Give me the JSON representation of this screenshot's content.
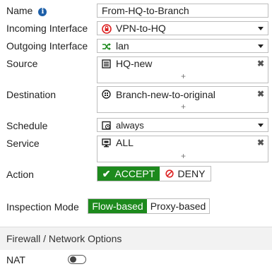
{
  "name": {
    "label": "Name",
    "value": "From-HQ-to-Branch"
  },
  "incoming": {
    "label": "Incoming Interface",
    "value": "VPN-to-HQ"
  },
  "outgoing": {
    "label": "Outgoing Interface",
    "value": "lan"
  },
  "source": {
    "label": "Source",
    "value": "HQ-new",
    "add": "+",
    "remove": "✖"
  },
  "destination": {
    "label": "Destination",
    "value": "Branch-new-to-original",
    "add": "+",
    "remove": "✖"
  },
  "schedule": {
    "label": "Schedule",
    "value": "always"
  },
  "service": {
    "label": "Service",
    "value": "ALL",
    "add": "+",
    "remove": "✖"
  },
  "action": {
    "label": "Action",
    "accept": "ACCEPT",
    "deny": "DENY",
    "selected": "ACCEPT"
  },
  "inspection": {
    "label": "Inspection Mode",
    "flow": "Flow-based",
    "proxy": "Proxy-based",
    "selected": "Flow-based"
  },
  "section_title": "Firewall / Network Options",
  "nat": {
    "label": "NAT",
    "enabled": false
  },
  "colors": {
    "accent_green": "#1d8a1d",
    "deny_red": "#d22",
    "info_blue": "#1d5fa8"
  }
}
